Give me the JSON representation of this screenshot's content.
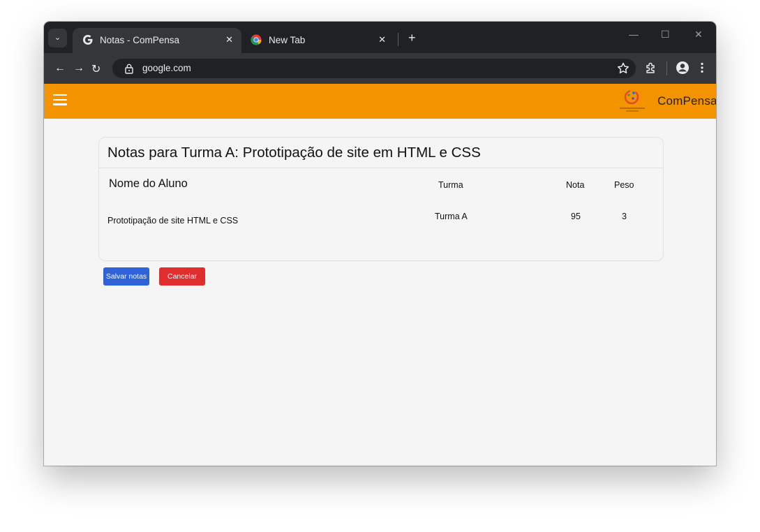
{
  "browser": {
    "tabs": [
      {
        "title": "Notas - ComPensa",
        "active": true,
        "favicon": "google-g-icon"
      },
      {
        "title": "New Tab",
        "active": false,
        "favicon": "chrome-icon"
      }
    ],
    "address": "google.com",
    "colors": {
      "frame": "#202124",
      "toolbar": "#35363a",
      "omnibox": "#202124"
    }
  },
  "app": {
    "brand": "ComPensa",
    "header_color": "#f39300"
  },
  "grades": {
    "title": "Notas para Turma A: Prototipação de site em HTML e CSS",
    "columns": {
      "name": "Nome do Aluno",
      "class": "Turma",
      "grade": "Nota",
      "weight": "Peso"
    },
    "rows": [
      {
        "name": "Prototipação de site HTML e CSS",
        "class": "Turma A",
        "grade": "95",
        "weight": "3"
      }
    ]
  },
  "actions": {
    "save_label": "Salvar notas",
    "cancel_label": "Cancelar",
    "save_color": "#2f62d7",
    "cancel_color": "#e02d2d"
  }
}
